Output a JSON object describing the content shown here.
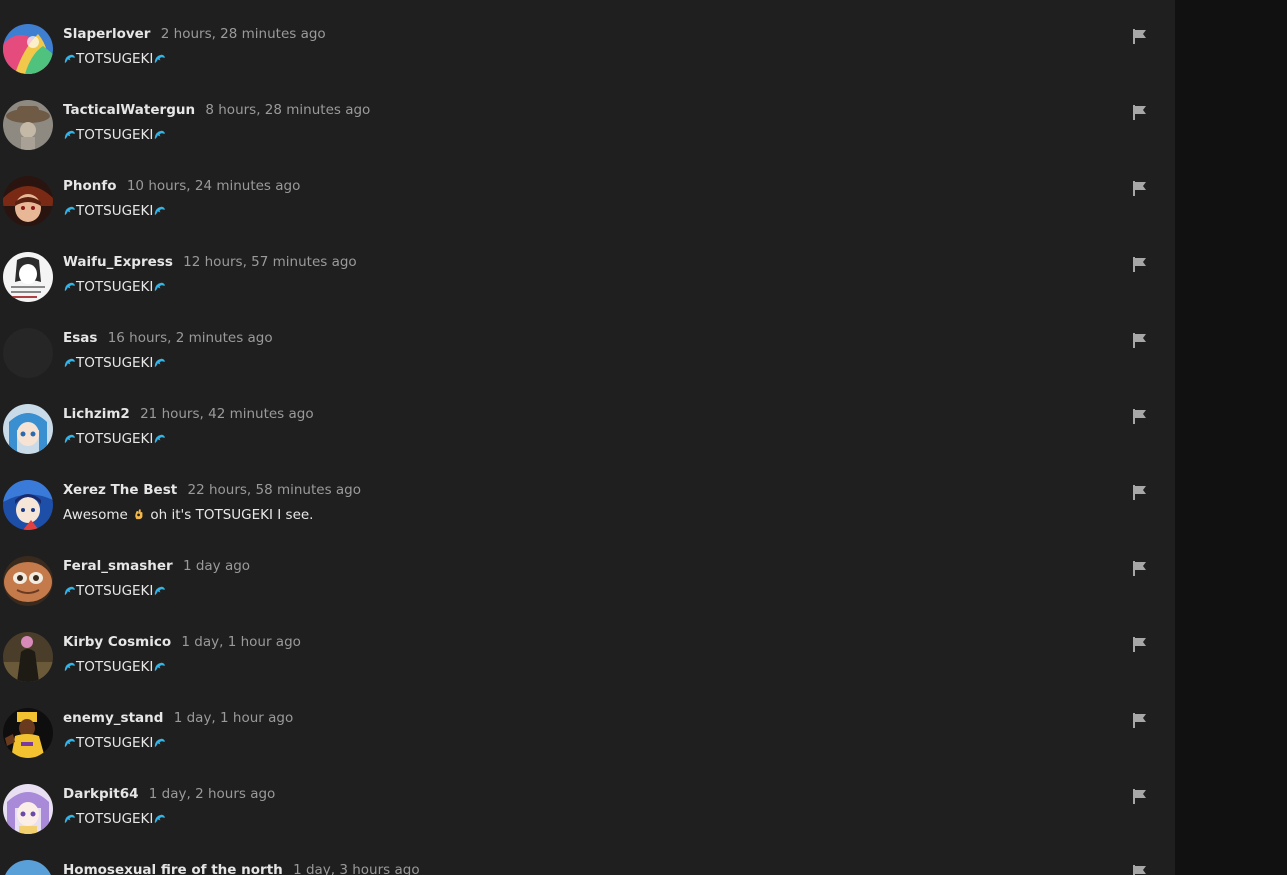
{
  "comments": [
    {
      "username": "Slaperlover",
      "time": "2 hours, 28 minutes ago",
      "pre": "",
      "text": "TOTSUGEKI",
      "avatar": "av-rainbow"
    },
    {
      "username": "TacticalWatergun",
      "time": "8 hours, 28 minutes ago",
      "pre": "",
      "text": "TOTSUGEKI",
      "avatar": "av-hat"
    },
    {
      "username": "Phonfo",
      "time": "10 hours, 24 minutes ago",
      "pre": "",
      "text": "TOTSUGEKI",
      "avatar": "av-witch"
    },
    {
      "username": "Waifu_Express",
      "time": "12 hours, 57 minutes ago",
      "pre": "",
      "text": "TOTSUGEKI",
      "avatar": "av-manga"
    },
    {
      "username": "Esas",
      "time": "16 hours, 2 minutes ago",
      "pre": "",
      "text": "TOTSUGEKI",
      "avatar": "av-blank"
    },
    {
      "username": "Lichzim2",
      "time": "21 hours, 42 minutes ago",
      "pre": "",
      "text": "TOTSUGEKI",
      "avatar": "av-blue-girl"
    },
    {
      "username": "Xerez The Best",
      "time": "22 hours, 58 minutes ago",
      "pre": "Awesome",
      "text": "oh it's TOTSUGEKI I see.",
      "avatar": "av-anime-blue"
    },
    {
      "username": "Feral_smasher",
      "time": "1 day ago",
      "pre": "",
      "text": "TOTSUGEKI",
      "avatar": "av-face"
    },
    {
      "username": "Kirby Cosmico",
      "time": "1 day, 1 hour ago",
      "pre": "",
      "text": "TOTSUGEKI",
      "avatar": "av-kirby"
    },
    {
      "username": "enemy_stand",
      "time": "1 day, 1 hour ago",
      "pre": "",
      "text": "TOTSUGEKI",
      "avatar": "av-yellow"
    },
    {
      "username": "Darkpit64",
      "time": "1 day, 2 hours ago",
      "pre": "",
      "text": "TOTSUGEKI",
      "avatar": "av-purple"
    },
    {
      "username": "Homosexual fire of the north",
      "time": "1 day, 3 hours ago",
      "pre": "",
      "text": "",
      "avatar": "av-blue-partial"
    }
  ],
  "colors": {
    "background": "#1f1f1f",
    "username": "#e6e6e6",
    "timestamp": "#9a9a9a",
    "dolphin": "#35b4e6",
    "flag": "#a7a7a7"
  },
  "icons": {
    "report": "flag-icon",
    "emoji": "dolphin-icon",
    "ok": "ok-hand-icon"
  }
}
